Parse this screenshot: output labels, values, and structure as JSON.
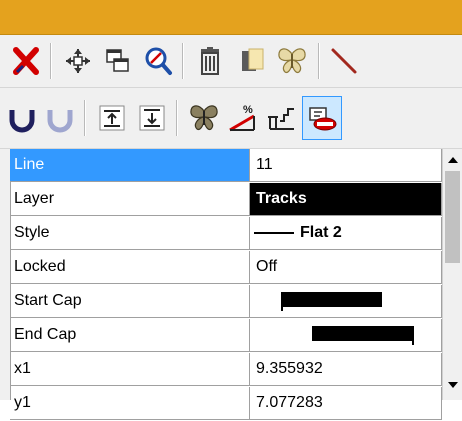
{
  "toolbar_row1": {
    "icons": [
      "delete-x-icon",
      "move-icon",
      "copy-window-icon",
      "zoom-icon",
      "trash-icon",
      "layer-copy-icon",
      "butterfly-icon",
      "line-tool-icon"
    ]
  },
  "toolbar_row2": {
    "icons": [
      "undo-icon",
      "redo-icon",
      "align-up-icon",
      "align-down-icon",
      "butterfly-dark-icon",
      "percent-grade-icon",
      "gradient-steps-icon",
      "track-label-icon"
    ]
  },
  "properties": {
    "rows": [
      {
        "name": "Line",
        "value": "11"
      },
      {
        "name": "Layer",
        "value": "Tracks"
      },
      {
        "name": "Style",
        "value": "Flat 2"
      },
      {
        "name": "Locked",
        "value": "Off"
      },
      {
        "name": "Start Cap",
        "value": ""
      },
      {
        "name": "End Cap",
        "value": ""
      },
      {
        "name": "x1",
        "value": "9.355932"
      },
      {
        "name": "y1",
        "value": "7.077283"
      }
    ]
  },
  "colors": {
    "titlebar": "#e4a21e",
    "selection": "#3399ff",
    "delete_red": "#d20000"
  }
}
